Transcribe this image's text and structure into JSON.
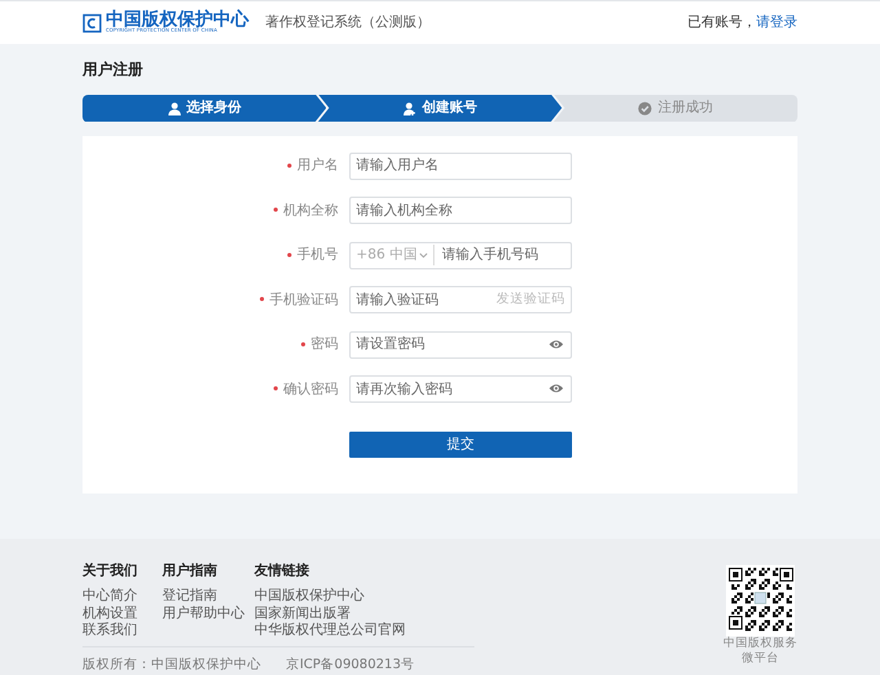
{
  "header": {
    "logo_text": "中国版权保护中心",
    "logo_subtitle": "COPYRIGHT PROTECTION CENTER OF CHINA",
    "system_name": "著作权登记系统（公测版）",
    "account_prompt": "已有账号，",
    "login_link": "请登录"
  },
  "page_title": "用户注册",
  "steps": [
    {
      "label": "选择身份",
      "active": true
    },
    {
      "label": "创建账号",
      "active": true
    },
    {
      "label": "注册成功",
      "active": false
    }
  ],
  "form": {
    "fields": [
      {
        "kind": "text",
        "label": "用户名",
        "required": true,
        "placeholder": "请输入用户名"
      },
      {
        "kind": "text",
        "label": "机构全称",
        "required": true,
        "placeholder": "请输入机构全称"
      },
      {
        "kind": "phone",
        "label": "手机号",
        "required": true,
        "prefix": "+86 中国",
        "placeholder": "请输入手机号码"
      },
      {
        "kind": "code",
        "label": "手机验证码",
        "required": true,
        "placeholder": "请输入验证码",
        "action": "发送验证码"
      },
      {
        "kind": "password",
        "label": "密码",
        "required": true,
        "placeholder": "请设置密码"
      },
      {
        "kind": "password",
        "label": "确认密码",
        "required": true,
        "placeholder": "请再次输入密码"
      }
    ],
    "submit": "提交"
  },
  "footer": {
    "columns": [
      {
        "title": "关于我们",
        "links": [
          "中心简介",
          "机构设置",
          "联系我们"
        ]
      },
      {
        "title": "用户指南",
        "links": [
          "登记指南",
          "用户帮助中心"
        ]
      },
      {
        "title": "友情链接",
        "links": [
          "中国版权保护中心",
          "国家新闻出版署",
          "中华版权代理总公司官网"
        ]
      }
    ],
    "copyright": "版权所有：中国版权保护中心",
    "icp": "京ICP备09080213号",
    "qr_caption": [
      "中国版权服务",
      "微平台"
    ]
  }
}
